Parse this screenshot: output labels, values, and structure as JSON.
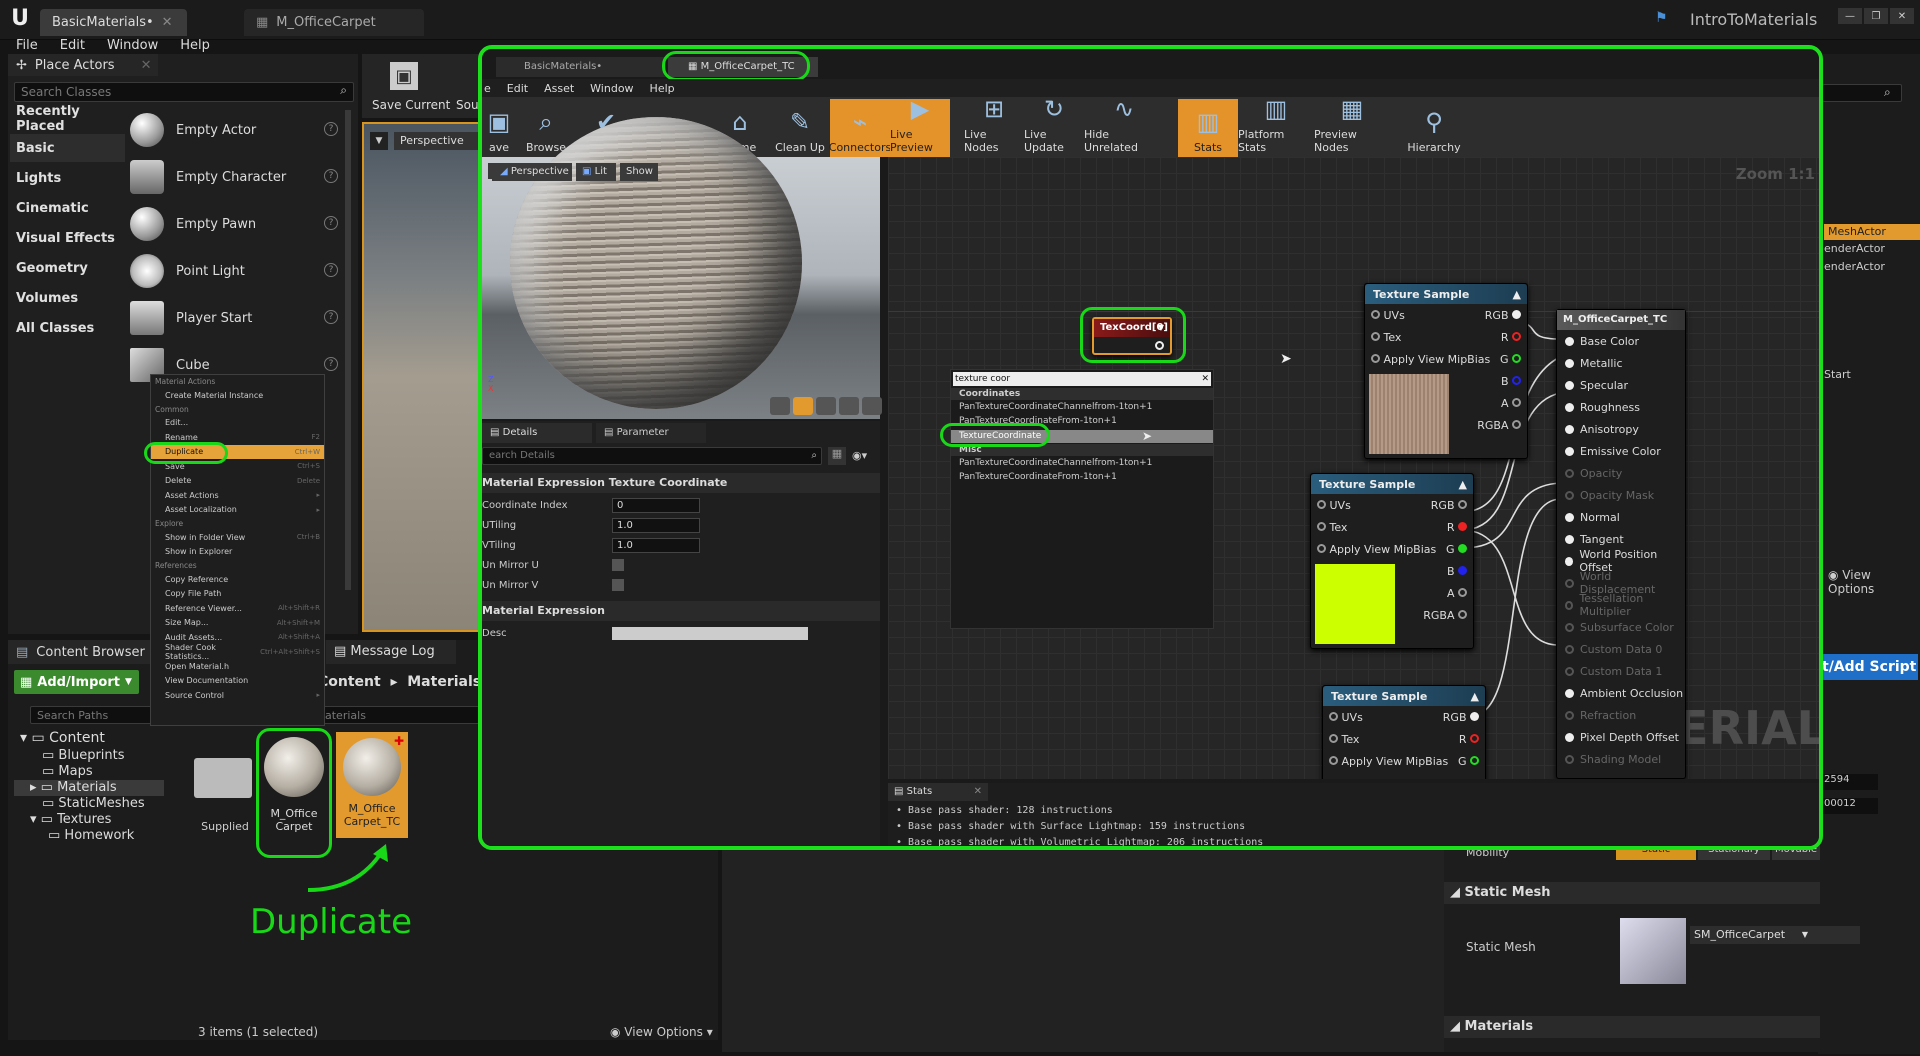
{
  "title_bar": {
    "tabs": [
      "BasicMaterials•",
      "M_OfficeCarpet"
    ],
    "project": "IntroToMaterials",
    "window_controls": [
      "—",
      "❐",
      "✕"
    ]
  },
  "menu": [
    "File",
    "Edit",
    "Window",
    "Help"
  ],
  "place_actors": {
    "title": "Place Actors",
    "search_placeholder": "Search Classes",
    "categories": [
      "Recently Placed",
      "Basic",
      "Lights",
      "Cinematic",
      "Visual Effects",
      "Geometry",
      "Volumes",
      "All Classes"
    ],
    "items": [
      "Empty Actor",
      "Empty Character",
      "Empty Pawn",
      "Point Light",
      "Player Start",
      "Cube"
    ]
  },
  "main_toolbar": {
    "save": "Save Current",
    "source": "Sou",
    "perspective": "Perspective"
  },
  "context_menu": {
    "sections": [
      {
        "title": "Material Actions",
        "items": [
          {
            "label": "Create Material Instance",
            "sc": ""
          }
        ]
      },
      {
        "title": "Common",
        "items": [
          {
            "label": "Edit...",
            "sc": ""
          },
          {
            "label": "Rename",
            "sc": "F2"
          },
          {
            "label": "Duplicate",
            "sc": "Ctrl+W",
            "hl": true
          },
          {
            "label": "Save",
            "sc": "Ctrl+S"
          },
          {
            "label": "Delete",
            "sc": "Delete"
          },
          {
            "label": "Asset Actions",
            "sc": "▸"
          },
          {
            "label": "Asset Localization",
            "sc": "▸"
          }
        ]
      },
      {
        "title": "Explore",
        "items": [
          {
            "label": "Show in Folder View",
            "sc": "Ctrl+B"
          },
          {
            "label": "Show in Explorer",
            "sc": ""
          }
        ]
      },
      {
        "title": "References",
        "items": [
          {
            "label": "Copy Reference",
            "sc": ""
          },
          {
            "label": "Copy File Path",
            "sc": ""
          },
          {
            "label": "Reference Viewer...",
            "sc": "Alt+Shift+R"
          },
          {
            "label": "Size Map...",
            "sc": "Alt+Shift+M"
          },
          {
            "label": "Audit Assets...",
            "sc": "Alt+Shift+A"
          },
          {
            "label": "Shader Cook Statistics...",
            "sc": "Ctrl+Alt+Shift+S"
          },
          {
            "label": "Open Material.h",
            "sc": ""
          },
          {
            "label": "View Documentation",
            "sc": ""
          },
          {
            "label": "Source Control",
            "sc": "▸"
          }
        ]
      }
    ]
  },
  "content_browser": {
    "title": "Content Browser",
    "message_log": "Message Log",
    "add_import": "Add/Import",
    "search_paths": "Search Paths",
    "breadcrumb": [
      "Content",
      "Materials"
    ],
    "filter_placeholder": "aterials",
    "tree": [
      "Content",
      "Blueprints",
      "Maps",
      "Materials",
      "StaticMeshes",
      "Textures",
      "Homework"
    ],
    "assets": [
      "Supplied",
      "M_Office Carpet",
      "M_Office Carpet_TC"
    ],
    "status": "3 items (1 selected)",
    "view_options": "View Options",
    "annotation": "Duplicate"
  },
  "material_editor": {
    "tabs": [
      "BasicMaterials•",
      "M_OfficeCarpet_TC"
    ],
    "menu": [
      "e",
      "Edit",
      "Asset",
      "Window",
      "Help"
    ],
    "toolbar": [
      "ave",
      "Browse",
      "Apply",
      "Search",
      "Home",
      "Clean Up",
      "Connectors",
      "Live Preview",
      "Live Nodes",
      "Live Update",
      "Hide Unrelated",
      "Stats",
      "Platform Stats",
      "Preview Nodes",
      "Hierarchy"
    ],
    "viewport_buttons": [
      "Perspective",
      "Lit",
      "Show"
    ],
    "details": {
      "tab": "Details",
      "tab2": "Parameter Defaults",
      "search": "earch Details",
      "section": "Material Expression Texture Coordinate",
      "props": [
        {
          "name": "Coordinate Index",
          "value": "0"
        },
        {
          "name": "UTiling",
          "value": "1.0"
        },
        {
          "name": "VTiling",
          "value": "1.0"
        },
        {
          "name": "Un Mirror U",
          "value": ""
        },
        {
          "name": "Un Mirror V",
          "value": ""
        }
      ],
      "section2": "Material Expression",
      "desc": "Desc"
    },
    "zoom": "Zoom 1:1",
    "texcoord": {
      "label": "TexCoord[0]"
    },
    "search_popup": {
      "query": "texture coor",
      "group1": "Coordinates",
      "items1": [
        "PanTextureCoordinateChannelfrom-1ton+1",
        "PanTextureCoordinateFrom-1ton+1",
        "TextureCoordinate"
      ],
      "group2": "Misc",
      "items2": [
        "PanTextureCoordinateChannelfrom-1ton+1",
        "PanTextureCoordinateFrom-1ton+1"
      ]
    },
    "tex1": {
      "title": "Texture Sample",
      "inputs": [
        "UVs",
        "Tex",
        "Apply View MipBias"
      ],
      "outputs": [
        "RGB",
        "R",
        "G",
        "B",
        "A",
        "RGBA"
      ]
    },
    "tex2": {
      "title": "Texture Sample",
      "inputs": [
        "UVs",
        "Tex",
        "Apply View MipBias"
      ],
      "outputs": [
        "RGB",
        "R",
        "G",
        "B",
        "A",
        "RGBA"
      ]
    },
    "tex3": {
      "title": "Texture Sample",
      "inputs": [
        "UVs",
        "Tex",
        "Apply View MipBias"
      ],
      "outputs": [
        "RGB",
        "R",
        "G"
      ]
    },
    "result": {
      "title": "M_OfficeCarpet_TC",
      "pins": [
        {
          "n": "Base Color",
          "on": true
        },
        {
          "n": "Metallic",
          "on": true
        },
        {
          "n": "Specular",
          "on": true
        },
        {
          "n": "Roughness",
          "on": true
        },
        {
          "n": "Anisotropy",
          "on": true
        },
        {
          "n": "Emissive Color",
          "on": true
        },
        {
          "n": "Opacity",
          "on": false
        },
        {
          "n": "Opacity Mask",
          "on": false
        },
        {
          "n": "Normal",
          "on": true
        },
        {
          "n": "Tangent",
          "on": true
        },
        {
          "n": "World Position Offset",
          "on": true
        },
        {
          "n": "World Displacement",
          "on": false
        },
        {
          "n": "Tessellation Multiplier",
          "on": false
        },
        {
          "n": "Subsurface Color",
          "on": false
        },
        {
          "n": "Custom Data 0",
          "on": false
        },
        {
          "n": "Custom Data 1",
          "on": false
        },
        {
          "n": "Ambient Occlusion",
          "on": true
        },
        {
          "n": "Refraction",
          "on": false
        },
        {
          "n": "Pixel Depth Offset",
          "on": true
        },
        {
          "n": "Shading Model",
          "on": false
        }
      ]
    },
    "watermark": "MATERIAL",
    "stats": {
      "title": "Stats",
      "lines": [
        "Base pass shader: 128 instructions",
        "Base pass shader with Surface Lightmap: 159 instructions",
        "Base pass shader with Volumetric Lightmap: 206 instructions"
      ]
    }
  },
  "right_panel": {
    "outliner": [
      "MeshActor",
      "enderActor",
      "enderActor",
      "Start"
    ],
    "view_options": "View Options",
    "blueprint": "t/Add Script",
    "values": [
      "2594",
      "00012"
    ],
    "mobility": {
      "label": "Mobility",
      "options": [
        "Static",
        "Stationary",
        "Movable"
      ]
    },
    "static_mesh_section": "Static Mesh",
    "static_mesh_label": "Static Mesh",
    "static_mesh_value": "SM_OfficeCarpet",
    "materials_section": "Materials"
  }
}
